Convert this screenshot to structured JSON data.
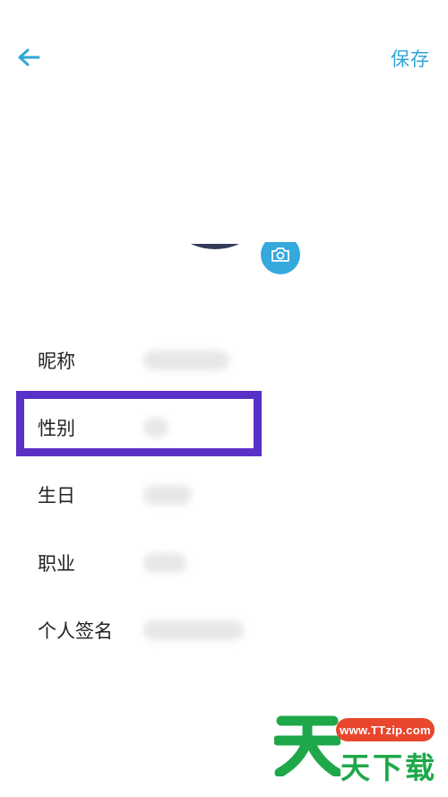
{
  "header": {
    "back_icon": "arrow-left-icon",
    "save_label": "保存",
    "accent_color": "#2fa6d6"
  },
  "avatar": {
    "camera_icon": "camera-icon"
  },
  "form": {
    "rows": [
      {
        "label": "昵称"
      },
      {
        "label": "性别"
      },
      {
        "label": "生日"
      },
      {
        "label": "职业"
      },
      {
        "label": "个人签名"
      }
    ],
    "highlight_color": "#5a31c6"
  },
  "watermark": {
    "big_char": "天",
    "url": "www.TTzip.com",
    "text": "天下载"
  }
}
